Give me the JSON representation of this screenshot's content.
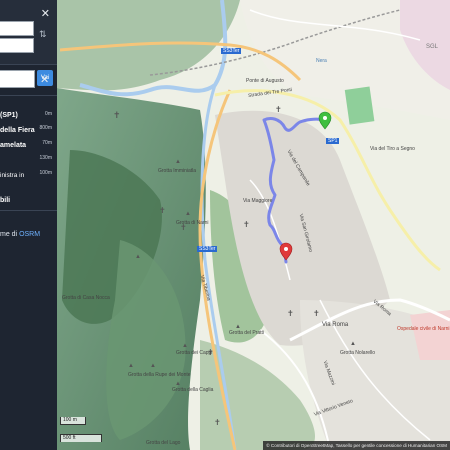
{
  "panel": {
    "swap_icon": "swap-icon",
    "close_icon": "close-icon",
    "go_button": "Vai",
    "route_steps": [
      {
        "text": "(SP1)",
        "distance": "0m",
        "bold": true
      },
      {
        "text": "della Fiera",
        "distance": "800m",
        "bold": true
      },
      {
        "text": "amelata",
        "distance": "70m",
        "bold": true
      },
      {
        "text": "",
        "distance": "130m",
        "bold": false
      },
      {
        "text": "inistra in",
        "distance": "100m",
        "bold": false
      },
      {
        "text": "bili",
        "distance": "",
        "bold": true
      }
    ],
    "osrm_prefix": "me di ",
    "osrm_link": "OSRM"
  },
  "map": {
    "labels": [
      "SGL",
      "Ponte di Augusto",
      "SS3Ter",
      "Nera",
      "Strada dei Tre Ponti",
      "SP1",
      "Via del Tiro a Segno",
      "Grotta Imminiatla",
      "Grotta di Narni",
      "Via Maggiore",
      "Via del Campanile",
      "Via San Girolamo",
      "Via Tiberina",
      "SS3Ter",
      "Grotta di Casa Nocca",
      "Grotta della Rupe dei Monte",
      "Grotta della Rupe del Monte Santa Croce",
      "Grotta della Caglia",
      "Grotta dei Cappi",
      "Grotta del Pratti",
      "Grotta del Lago",
      "Via Roma",
      "Via Roma",
      "Grotta Nolarello",
      "Ospedale civile di Narni",
      "Via Mazzini",
      "Via Vittorio Veneto",
      "Grotta del Mulino"
    ],
    "scale_m": "100 m",
    "scale_ft": "500 ft",
    "attribution": "© Contributori di OpenStreetMap, Tassello per gentile concessione di Humanitarian OSM"
  },
  "colors": {
    "panel_bg": "#1e2531",
    "accent": "#3d8be0",
    "route": "#7b86e8",
    "start_marker": "#3fbf3f",
    "end_marker": "#e03a3a"
  }
}
